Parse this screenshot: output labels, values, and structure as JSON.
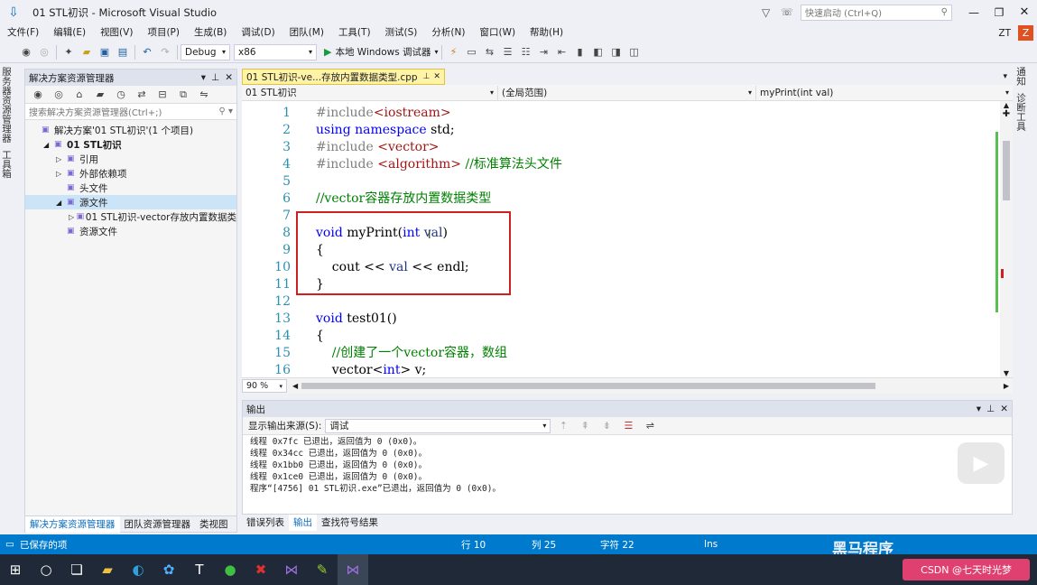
{
  "window": {
    "title": "01 STL初识 - Microsoft Visual Studio",
    "quick_launch_placeholder": "快速启动 (Ctrl+Q)",
    "user": "ZT"
  },
  "menu": [
    "文件(F)",
    "编辑(E)",
    "视图(V)",
    "项目(P)",
    "生成(B)",
    "调试(D)",
    "团队(M)",
    "工具(T)",
    "测试(S)",
    "分析(N)",
    "窗口(W)",
    "帮助(H)"
  ],
  "toolbar": {
    "config": "Debug",
    "platform": "x86",
    "run_label": "本地 Windows 调试器"
  },
  "left_strip": [
    "服务器资源管理器",
    "工具箱"
  ],
  "right_strip": [
    "通知",
    "诊断工具"
  ],
  "solution_explorer": {
    "title": "解决方案资源管理器",
    "search_placeholder": "搜索解决方案资源管理器(Ctrl+;)",
    "items": [
      {
        "label": "解决方案'01 STL初识'(1 个项目)",
        "indent": 0,
        "expander": ""
      },
      {
        "label": "01 STL初识",
        "indent": 1,
        "expander": "◢",
        "bold": true
      },
      {
        "label": "引用",
        "indent": 2,
        "expander": "▷"
      },
      {
        "label": "外部依赖项",
        "indent": 2,
        "expander": "▷"
      },
      {
        "label": "头文件",
        "indent": 2,
        "expander": ""
      },
      {
        "label": "源文件",
        "indent": 2,
        "expander": "◢",
        "selected": true
      },
      {
        "label": "01 STL初识-vector存放内置数据类",
        "indent": 3,
        "expander": "▷"
      },
      {
        "label": "资源文件",
        "indent": 2,
        "expander": ""
      }
    ],
    "bottom_tabs": [
      "解决方案资源管理器",
      "团队资源管理器",
      "类视图"
    ]
  },
  "editor": {
    "tab": "01 STL初识-ve...存放内置数据类型.cpp",
    "nav": {
      "project": "01 STL初识",
      "scope": "(全局范围)",
      "member": "myPrint(int val)"
    },
    "zoom": "90 %",
    "lines": [
      {
        "n": "1",
        "tokens": [
          [
            "pp",
            "#include"
          ],
          [
            "st",
            "<iostream>"
          ]
        ]
      },
      {
        "n": "2",
        "tokens": [
          [
            "kw",
            "using"
          ],
          [
            "",
            " "
          ],
          [
            "kw",
            "namespace"
          ],
          [
            "",
            " std;"
          ]
        ]
      },
      {
        "n": "3",
        "tokens": [
          [
            "pp",
            "#include "
          ],
          [
            "st",
            "<vector>"
          ]
        ]
      },
      {
        "n": "4",
        "tokens": [
          [
            "pp",
            "#include "
          ],
          [
            "st",
            "<algorithm>"
          ],
          [
            "cm",
            " //标准算法头文件"
          ]
        ]
      },
      {
        "n": "5",
        "tokens": []
      },
      {
        "n": "6",
        "tokens": [
          [
            "cm",
            "//vector容器存放内置数据类型"
          ]
        ]
      },
      {
        "n": "7",
        "tokens": []
      },
      {
        "n": "8",
        "tokens": [
          [
            "kw",
            "void"
          ],
          [
            "",
            " myPrint("
          ],
          [
            "kw",
            "int"
          ],
          [
            "id",
            " val"
          ],
          [
            "",
            ")"
          ]
        ]
      },
      {
        "n": "9",
        "tokens": [
          [
            "",
            "{"
          ]
        ]
      },
      {
        "n": "10",
        "tokens": [
          [
            "",
            "    cout << "
          ],
          [
            "id",
            "val"
          ],
          [
            "",
            " << endl;"
          ]
        ]
      },
      {
        "n": "11",
        "tokens": [
          [
            "",
            "}"
          ]
        ]
      },
      {
        "n": "12",
        "tokens": []
      },
      {
        "n": "13",
        "tokens": [
          [
            "kw",
            "void"
          ],
          [
            "",
            " test01()"
          ]
        ]
      },
      {
        "n": "14",
        "tokens": [
          [
            "",
            "{"
          ]
        ]
      },
      {
        "n": "15",
        "tokens": [
          [
            "cm",
            "    //创建了一个vector容器，数组"
          ]
        ]
      },
      {
        "n": "16",
        "tokens": [
          [
            "",
            "    vector<"
          ],
          [
            "kw",
            "int"
          ],
          [
            "",
            "> v;"
          ]
        ]
      }
    ]
  },
  "output": {
    "title": "输出",
    "source_label": "显示输出来源(S):",
    "source_value": "调试",
    "lines": [
      "线程 0x7fc 已退出，返回值为 0 (0x0)。",
      "线程 0x34cc 已退出，返回值为 0 (0x0)。",
      "线程 0x1bb0 已退出，返回值为 0 (0x0)。",
      "线程 0x1ce0 已退出，返回值为 0 (0x0)。",
      "程序“[4756] 01 STL初识.exe”已退出，返回值为 0 (0x0)。"
    ],
    "bottom_tabs": [
      "错误列表",
      "输出",
      "查找符号结果"
    ]
  },
  "status": {
    "message": "已保存的项",
    "line": "行 10",
    "col": "列 25",
    "char": "字符 22",
    "mode": "Ins"
  },
  "watermark": {
    "brand": "黑马程序",
    "caption": "CSDN @七天时光梦"
  },
  "colors": {
    "accent": "#007acc",
    "highlight_box": "#d01f1f",
    "tab_active": "#fff3a8"
  }
}
